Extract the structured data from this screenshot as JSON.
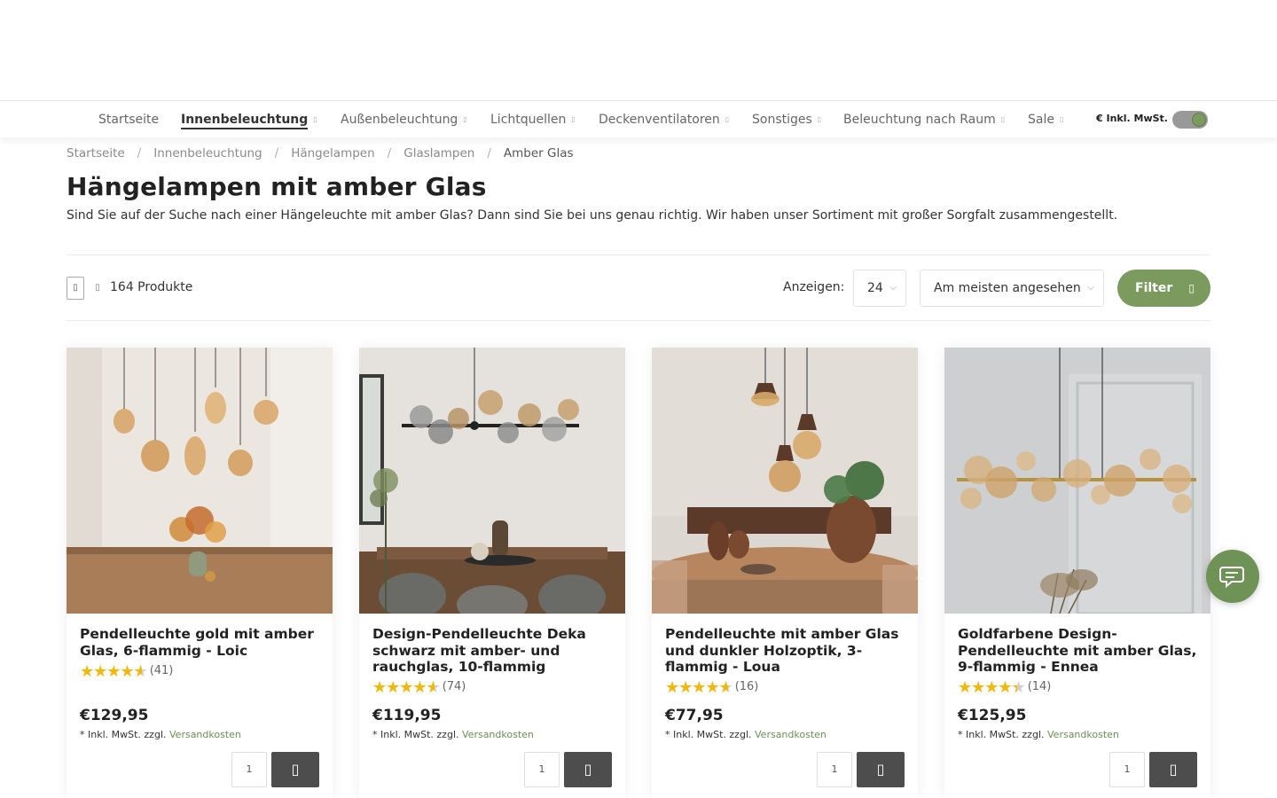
{
  "nav": {
    "items": [
      {
        "label": "Startseite",
        "chevron": false,
        "active": false
      },
      {
        "label": "Innenbeleuchtung",
        "chevron": true,
        "active": true
      },
      {
        "label": "Außenbeleuchtung",
        "chevron": true,
        "active": false
      },
      {
        "label": "Lichtquellen",
        "chevron": true,
        "active": false
      },
      {
        "label": "Deckenventilatoren",
        "chevron": true,
        "active": false
      },
      {
        "label": "Sonstiges",
        "chevron": true,
        "active": false
      },
      {
        "label": "Beleuchtung nach Raum",
        "chevron": true,
        "active": false
      },
      {
        "label": "Sale",
        "chevron": true,
        "active": false
      }
    ],
    "chevron_glyph": "▯"
  },
  "vat_toggle": {
    "label": "€ Inkl. MwSt.",
    "knob_glyph": "▯",
    "on": true
  },
  "breadcrumb": {
    "items": [
      "Startseite",
      "Innenbeleuchtung",
      "Hängelampen",
      "Glaslampen",
      "Amber Glas"
    ],
    "separator": "/"
  },
  "page": {
    "title": "Hängelampen mit amber Glas",
    "description": "Sind Sie auf der Suche nach einer Hängeleuchte mit amber Glas? Dann sind Sie bei uns genau richtig. Wir haben unser Sortiment mit großer Sorgfalt zusammengestellt."
  },
  "toolbar": {
    "grid_icon_glyph": "▯",
    "list_icon_glyph": "▯",
    "count_label": "164 Produkte",
    "show_label": "Anzeigen:",
    "per_page_value": "24",
    "sort_value": "Am meisten angesehen",
    "caret_glyph": "⌵",
    "filter_label": "Filter",
    "filter_icon_glyph": "▯"
  },
  "products": [
    {
      "name": "Pendelleuchte gold mit amber Glas, 6-flammig - Loic",
      "rating": 4.6,
      "reviews": "(41)",
      "price": "€129,95",
      "tax_prefix": "* Inkl. MwSt. zzgl.",
      "shipping_link": "Versandkosten",
      "qty": "1",
      "cart_glyph": "▯"
    },
    {
      "name": "Design-Pendelleuchte Deka schwarz mit amber- und rauchglas, 10-flammig",
      "rating": 4.6,
      "reviews": "(74)",
      "price": "€119,95",
      "tax_prefix": "* Inkl. MwSt. zzgl.",
      "shipping_link": "Versandkosten",
      "qty": "1",
      "cart_glyph": "▯"
    },
    {
      "name": "Pendelleuchte mit amber Glas und dunkler Holzoptik, 3-flammig - Loua",
      "rating": 4.7,
      "reviews": "(16)",
      "price": "€77,95",
      "tax_prefix": "* Inkl. MwSt. zzgl.",
      "shipping_link": "Versandkosten",
      "qty": "1",
      "cart_glyph": "▯"
    },
    {
      "name": "Goldfarbene Design-Pendelleuchte mit amber Glas, 9-flammig - Ennea",
      "rating": 4.4,
      "reviews": "(14)",
      "price": "€125,95",
      "tax_prefix": "* Inkl. MwSt. zzgl.",
      "shipping_link": "Versandkosten",
      "qty": "1",
      "cart_glyph": "▯"
    }
  ],
  "colors": {
    "accent_green": "#7a9a5e",
    "cart_button": "#4d4d4d",
    "star": "#f2b807",
    "link": "#6d8e55"
  }
}
